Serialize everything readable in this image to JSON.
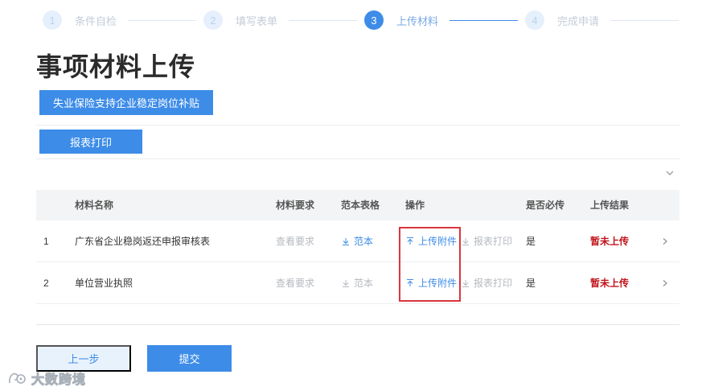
{
  "steps": [
    {
      "num": "1",
      "label": "条件自检"
    },
    {
      "num": "2",
      "label": "填写表单"
    },
    {
      "num": "3",
      "label": "上传材料"
    },
    {
      "num": "4",
      "label": "完成申请"
    }
  ],
  "page": {
    "title": "事项材料上传",
    "subsidy_button": "失业保险支持企业稳定岗位补贴",
    "print_button": "报表打印"
  },
  "table": {
    "headers": {
      "name": "材料名称",
      "requirement": "材料要求",
      "template": "范本表格",
      "operation": "操作",
      "required": "是否必传",
      "result": "上传结果"
    },
    "rows": [
      {
        "index": "1",
        "name": "广东省企业稳岗返还申报审核表",
        "requirement": "查看要求",
        "template": "范本",
        "upload": "上传附件",
        "print": "报表打印",
        "required": "是",
        "result": "暂未上传"
      },
      {
        "index": "2",
        "name": "单位营业执照",
        "requirement": "查看要求",
        "template": "范本",
        "upload": "上传附件",
        "print": "报表打印",
        "required": "是",
        "result": "暂未上传"
      }
    ]
  },
  "footer": {
    "prev_button": "上一步",
    "submit_button": "提交"
  },
  "watermark": {
    "text": "大数跨境"
  },
  "colors": {
    "primary": "#3d8ce8",
    "danger": "#c0141b",
    "highlight": "#d9363e"
  }
}
